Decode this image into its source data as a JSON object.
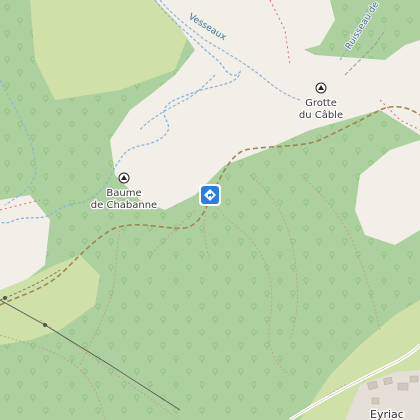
{
  "map": {
    "colors": {
      "background": "#f2efe9",
      "forest": "#add19e",
      "meadow": "#cfe0a8",
      "scrub": "#c8d7ab",
      "water": "#8fb4d9",
      "path": "#a0864f",
      "boundary": "#e06b6b",
      "marker": "#2a7de1"
    },
    "features": {
      "cave_1": {
        "label_line1": "Baume",
        "label_line2": "de Chabanne",
        "icon": "cave-icon"
      },
      "cave_2": {
        "label_line1": "Grotte",
        "label_line2": "du Câble",
        "icon": "cave-icon"
      },
      "river_1": {
        "label": "Vesseaux"
      },
      "river_2": {
        "label": "Ruisseau de"
      },
      "town": {
        "label": "Eyriac"
      }
    },
    "marker": {
      "icon": "directions-icon"
    }
  }
}
